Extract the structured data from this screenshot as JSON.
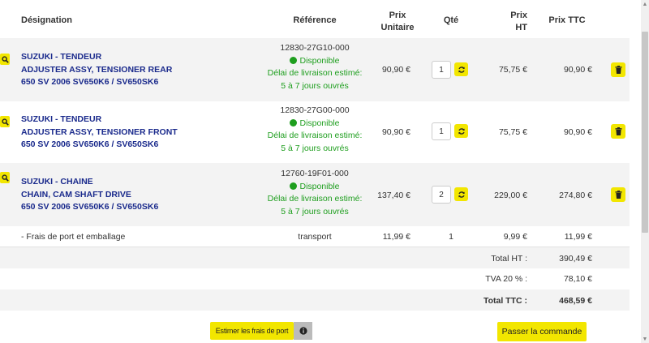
{
  "headers": {
    "designation": "Désignation",
    "reference": "Référence",
    "prix_unitaire_1": "Prix",
    "prix_unitaire_2": "Unitaire",
    "qte": "Qté",
    "prix_ht_1": "Prix",
    "prix_ht_2": "HT",
    "prix_ttc": "Prix TTC"
  },
  "items": [
    {
      "line1": "SUZUKI - TENDEUR",
      "line2": "ADJUSTER ASSY, TENSIONER REAR",
      "line3": "650 SV 2006 SV650K6 / SV650SK6",
      "code": "12830-27G10-000",
      "status": "Disponible",
      "delay_label": "Délai de livraison estimé:",
      "delay_value": "5 à 7 jours ouvrés",
      "unit_price": "90,90 €",
      "qty": "1",
      "price_ht": "75,75 €",
      "price_ttc": "90,90 €"
    },
    {
      "line1": "SUZUKI - TENDEUR",
      "line2": "ADJUSTER ASSY, TENSIONER FRONT",
      "line3": "650 SV 2006 SV650K6 / SV650SK6",
      "code": "12830-27G00-000",
      "status": "Disponible",
      "delay_label": "Délai de livraison estimé:",
      "delay_value": "5 à 7 jours ouvrés",
      "unit_price": "90,90 €",
      "qty": "1",
      "price_ht": "75,75 €",
      "price_ttc": "90,90 €"
    },
    {
      "line1": "SUZUKI - CHAINE",
      "line2": "CHAIN, CAM SHAFT DRIVE",
      "line3": "650 SV 2006 SV650K6 / SV650SK6",
      "code": "12760-19F01-000",
      "status": "Disponible",
      "delay_label": "Délai de livraison estimé:",
      "delay_value": "5 à 7 jours ouvrés",
      "unit_price": "137,40 €",
      "qty": "2",
      "price_ht": "229,00 €",
      "price_ttc": "274,80 €"
    }
  ],
  "shipping": {
    "label": "- Frais de port et emballage",
    "reference": "transport",
    "unit_price": "11,99 €",
    "qty": "1",
    "price_ht": "9,99 €",
    "price_ttc": "11,99 €"
  },
  "totals": {
    "total_ht_label": "Total HT :",
    "total_ht": "390,49 €",
    "tva_label": "TVA 20 % :",
    "tva": "78,10 €",
    "total_ttc_label": "Total TTC :",
    "total_ttc": "468,59 €"
  },
  "buttons": {
    "estimate": "Estimer les frais de port",
    "order": "Passer la commande"
  },
  "colors": {
    "accent_yellow": "#f2e600",
    "designation_blue": "#1a2a8c",
    "available_green": "#1e9e1e"
  },
  "icons": {
    "search": "magnifier-icon",
    "refresh": "refresh-icon",
    "delete": "trash-icon",
    "info": "info-icon",
    "status": "green-dot"
  }
}
